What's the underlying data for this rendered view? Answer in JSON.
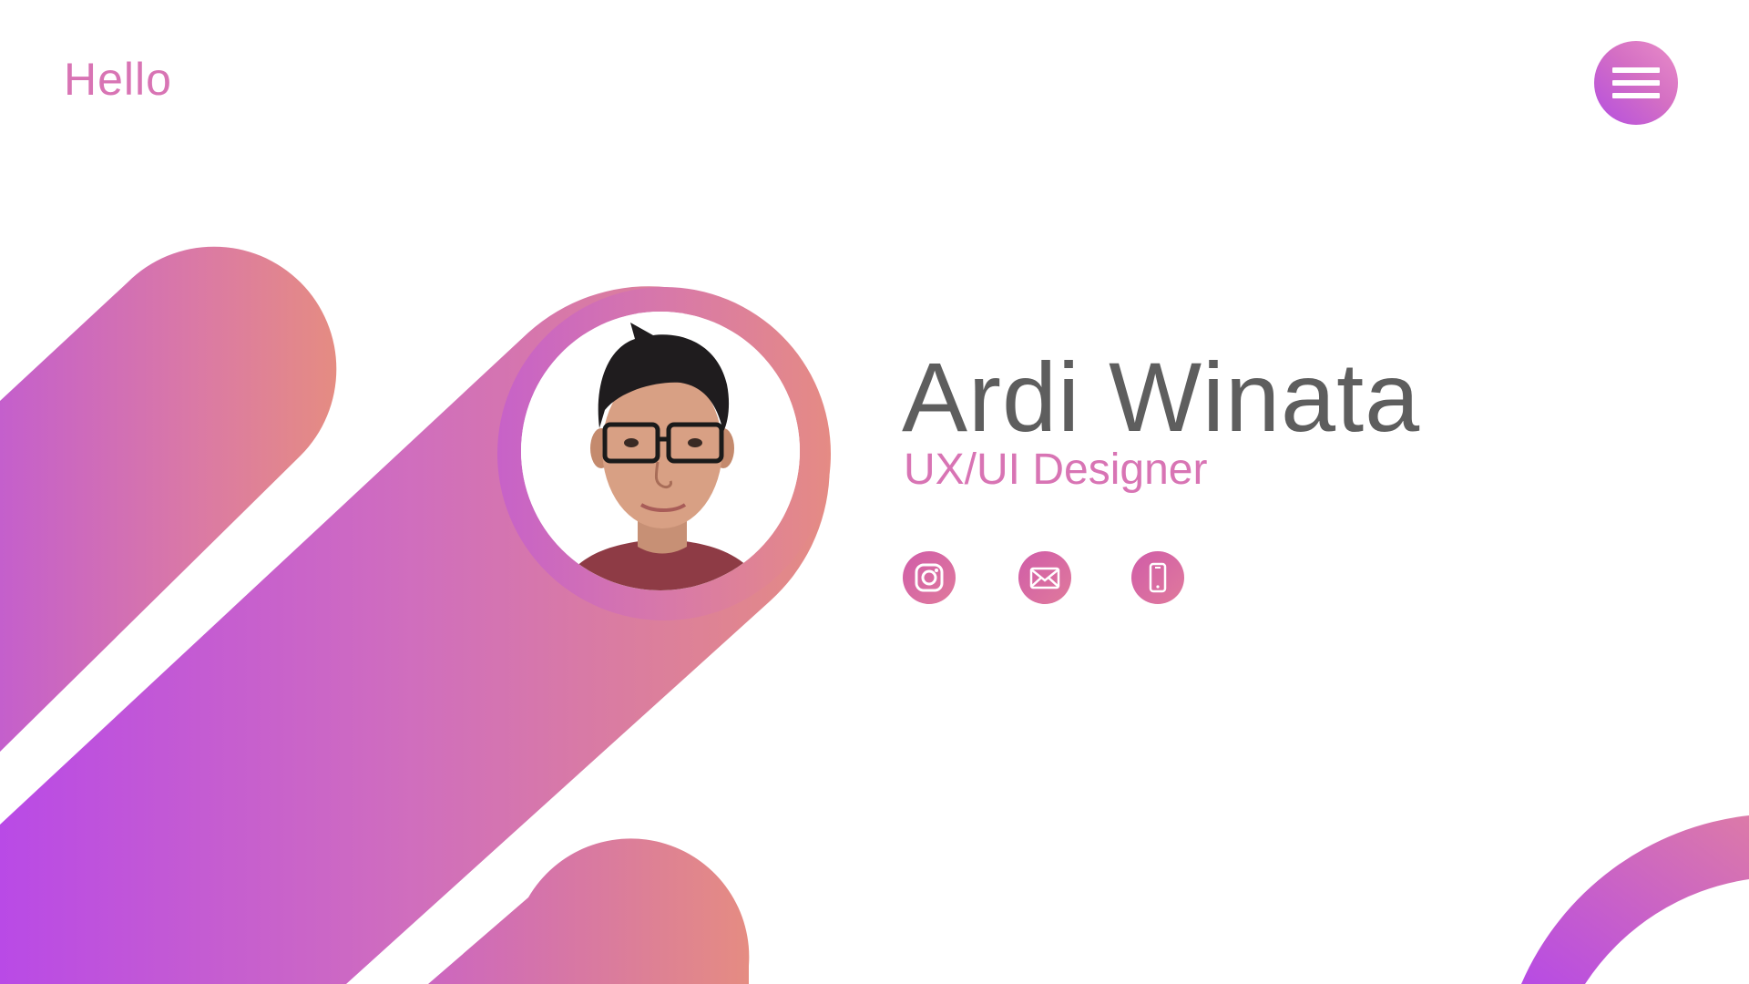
{
  "header": {
    "greeting": "Hello",
    "menu_icon": "hamburger-menu-icon"
  },
  "profile": {
    "name": "Ardi Winata",
    "title": "UX/UI Designer",
    "photo_icon": "profile-photo"
  },
  "social_links": [
    {
      "name": "instagram",
      "icon": "instagram-icon"
    },
    {
      "name": "email",
      "icon": "envelope-icon"
    },
    {
      "name": "phone",
      "icon": "smartphone-icon"
    }
  ],
  "colors": {
    "accent_pink": "#d874b4",
    "gradient_purple": "#b44ee0",
    "gradient_peach": "#e58b84",
    "name_text": "#5e5e5e"
  }
}
